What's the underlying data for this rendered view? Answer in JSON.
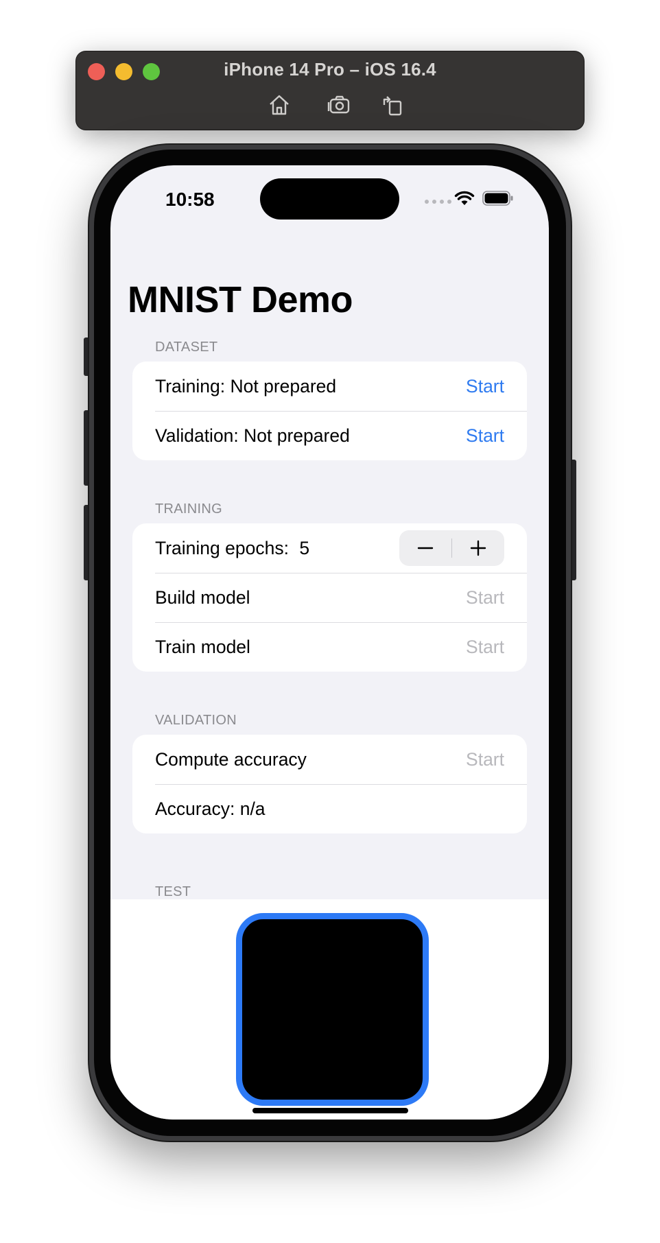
{
  "simulator": {
    "title": "iPhone 14 Pro – iOS 16.4",
    "buttons": [
      "home-icon",
      "screenshot-icon",
      "rotate-icon"
    ]
  },
  "status_bar": {
    "time": "10:58"
  },
  "app": {
    "title": "MNIST Demo",
    "sections": {
      "dataset": {
        "header": "DATASET",
        "rows": [
          {
            "label": "Training: Not prepared",
            "action": "Start",
            "enabled": true
          },
          {
            "label": "Validation: Not prepared",
            "action": "Start",
            "enabled": true
          }
        ]
      },
      "training": {
        "header": "TRAINING",
        "epochs_label": "Training epochs:",
        "epochs_value": "5",
        "stepper_minus": "−",
        "stepper_plus": "+",
        "rows": [
          {
            "label": "Build model",
            "action": "Start",
            "enabled": false
          },
          {
            "label": "Train model",
            "action": "Start",
            "enabled": false
          }
        ]
      },
      "validation": {
        "header": "VALIDATION",
        "rows": [
          {
            "label": "Compute accuracy",
            "action": "Start",
            "enabled": false
          },
          {
            "label": "Accuracy: n/a"
          }
        ]
      },
      "test": {
        "header": "TEST"
      }
    }
  },
  "colors": {
    "accent": "#2f7bf0",
    "disabled": "#b8b8bc",
    "group_background": "#f2f2f7",
    "drawing_border": "#2d7af6",
    "drawing_fill": "#000000"
  }
}
